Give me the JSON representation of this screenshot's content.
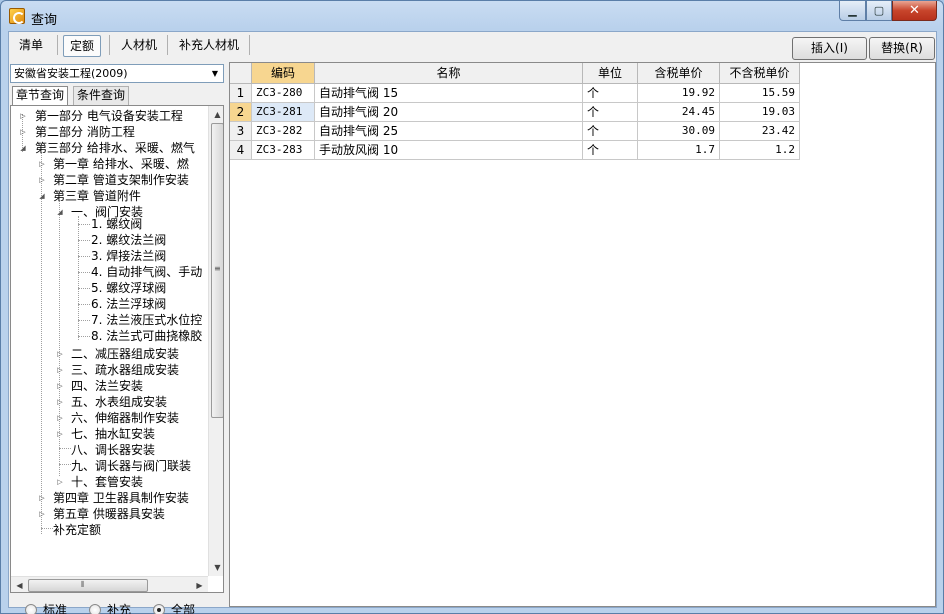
{
  "window": {
    "title": "查询"
  },
  "toolbar": {
    "tabs": [
      {
        "label": "清单"
      },
      {
        "label": "定额"
      },
      {
        "label": "人材机"
      },
      {
        "label": "补充人材机"
      }
    ],
    "insert_label": "插入(I)",
    "replace_label": "替换(R)"
  },
  "left": {
    "library": "安徽省安装工程(2009)",
    "subtabs": [
      {
        "label": "章节查询"
      },
      {
        "label": "条件查询"
      }
    ],
    "tree": [
      {
        "label": "第一部分  电气设备安装工程"
      },
      {
        "label": "第二部分  消防工程"
      },
      {
        "label": "第三部分  给排水、采暖、燃气"
      },
      {
        "label": "第一章  给排水、采暖、燃"
      },
      {
        "label": "第二章  管道支架制作安装"
      },
      {
        "label": "第三章  管道附件"
      },
      {
        "label": "一、阀门安装"
      },
      {
        "label": "1. 螺纹阀"
      },
      {
        "label": "2. 螺纹法兰阀"
      },
      {
        "label": "3. 焊接法兰阀"
      },
      {
        "label": "4. 自动排气阀、手动"
      },
      {
        "label": "5. 螺纹浮球阀"
      },
      {
        "label": "6. 法兰浮球阀"
      },
      {
        "label": "7. 法兰液压式水位控"
      },
      {
        "label": "8. 法兰式可曲挠橡胶"
      },
      {
        "label": "二、减压器组成安装"
      },
      {
        "label": "三、疏水器组成安装"
      },
      {
        "label": "四、法兰安装"
      },
      {
        "label": "五、水表组成安装"
      },
      {
        "label": "六、伸缩器制作安装"
      },
      {
        "label": "七、抽水缸安装"
      },
      {
        "label": "八、调长器安装"
      },
      {
        "label": "九、调长器与阀门联装"
      },
      {
        "label": "十、套管安装"
      },
      {
        "label": "第四章  卫生器具制作安装"
      },
      {
        "label": "第五章  供暖器具安装"
      },
      {
        "label": "补充定额"
      }
    ],
    "radios": [
      {
        "label": "标准"
      },
      {
        "label": "补充"
      },
      {
        "label": "全部"
      }
    ]
  },
  "table": {
    "headers": {
      "code": "编码",
      "name": "名称",
      "unit": "单位",
      "price_tax": "含税单价",
      "price_notax": "不含税单价"
    },
    "rows": [
      {
        "no": "1",
        "code": "ZC3-280",
        "name": "自动排气阀 15",
        "unit": "个",
        "price_tax": "19.92",
        "price_notax": "15.59"
      },
      {
        "no": "2",
        "code": "ZC3-281",
        "name": "自动排气阀 20",
        "unit": "个",
        "price_tax": "24.45",
        "price_notax": "19.03"
      },
      {
        "no": "3",
        "code": "ZC3-282",
        "name": "自动排气阀 25",
        "unit": "个",
        "price_tax": "30.09",
        "price_notax": "23.42"
      },
      {
        "no": "4",
        "code": "ZC3-283",
        "name": "手动放风阀 10",
        "unit": "个",
        "price_tax": "1.7",
        "price_notax": "1.2"
      }
    ]
  }
}
